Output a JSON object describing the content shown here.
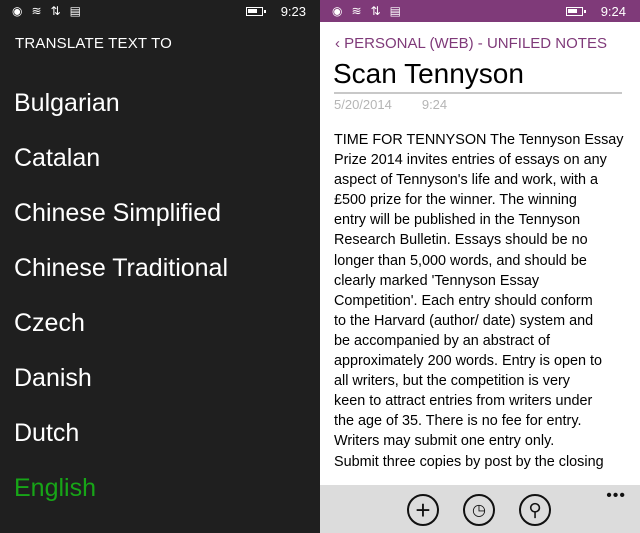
{
  "left": {
    "status": {
      "time": "9:23"
    },
    "title": "TRANSLATE TEXT TO",
    "languages": [
      "Bulgarian",
      "Catalan",
      "Chinese Simplified",
      "Chinese Traditional",
      "Czech",
      "Danish",
      "Dutch",
      "English"
    ],
    "selected": "English"
  },
  "right": {
    "status": {
      "time": "9:24"
    },
    "breadcrumb": "‹ PERSONAL (WEB) - UNFILED NOTES",
    "title": "Scan Tennyson",
    "date": "5/20/2014",
    "time": "9:24",
    "body_lines": [
      "TIME FOR TENNYSON The Tennyson Essay",
      "Prize 2014 invites entries of essays on any",
      "aspect of Tennyson's life and work, with a",
      "£500 prize for the winner. The winning",
      "entry will be published in the Tennyson",
      "Research Bulletin. Essays should be no",
      "longer than 5,000 words, and should be",
      "clearly marked 'Tennyson Essay",
      "Competition'. Each entry should conform",
      "to the Harvard (author/ date) system and",
      "be accompanied by an abstract of",
      "approximately 200 words. Entry is open to",
      "all writers, but the competition is very",
      "keen to attract entries from writers under",
      "the age of 35. There is no fee for entry.",
      "Writers may submit one entry only.",
      "Submit three copies by post by the closing"
    ],
    "appbar": {
      "add": "+",
      "recent": "◷",
      "search": "⚲",
      "more": "•••"
    }
  },
  "colors": {
    "accent": "#7f3a79",
    "selected": "#17a517"
  }
}
